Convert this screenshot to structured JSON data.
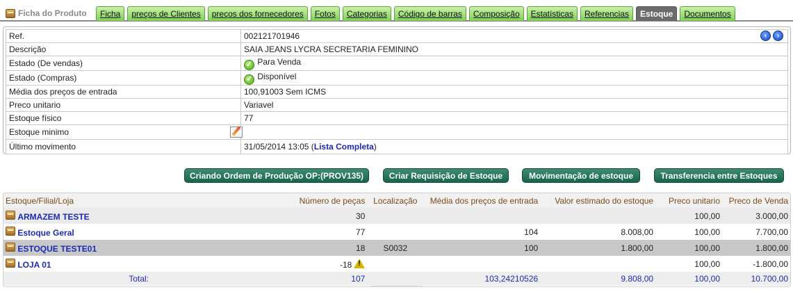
{
  "tabs": {
    "title": "Ficha do Produto",
    "items": [
      {
        "label": "Ficha"
      },
      {
        "label": "preços de Clientes"
      },
      {
        "label": "preços dos fornecedores"
      },
      {
        "label": "Fotos"
      },
      {
        "label": "Categorias"
      },
      {
        "label": "Código de barras"
      },
      {
        "label": "Composição"
      },
      {
        "label": "Estatísticas"
      },
      {
        "label": "Referencias"
      },
      {
        "label": "Estoque",
        "active": true
      },
      {
        "label": "Documentos"
      }
    ]
  },
  "details": {
    "rows": [
      {
        "label": "Ref.",
        "value": "002121701946"
      },
      {
        "label": "Descrição",
        "value": "SAIA JEANS LYCRA SECRETARIA FEMININO"
      },
      {
        "label": "Estado (De vendas)",
        "value": "Para Venda"
      },
      {
        "label": "Estado (Compras)",
        "value": "Disponível"
      },
      {
        "label": "Média dos preços de entrada",
        "value": "100,91003 Sem ICMS"
      },
      {
        "label": "Preco unitario",
        "value": "Variavel"
      },
      {
        "label": "Estoque físico",
        "value": "77"
      },
      {
        "label": "Estoque minimo",
        "value": ""
      },
      {
        "label": "Último movimento",
        "value": "31/05/2014 13:05",
        "link": "Lista Completa"
      }
    ]
  },
  "buttons": {
    "production_order": "Criando Ordem de Produção OP:(PROV135)",
    "stock_request": "Criar Requisição de Estoque",
    "stock_movement": "Movimentação de estoque",
    "stock_transfer": "Transferencia entre Estoques"
  },
  "stock_table": {
    "headers": {
      "store": "Estoque/Filial/Loja",
      "qty": "Número de peças",
      "location": "Localização",
      "avg_price": "Média dos preços de entrada",
      "est_value": "Valor estimado do estoque",
      "unit_price": "Preco unitario",
      "sale_price": "Preco de Venda"
    },
    "rows": [
      {
        "store": "ARMAZEM TESTE",
        "qty": "30",
        "location": "",
        "avg_price": "",
        "est_value": "",
        "unit_price": "100,00",
        "sale_price": "3.000,00"
      },
      {
        "store": "Estoque Geral",
        "qty": "77",
        "location": "",
        "avg_price": "104",
        "est_value": "8.008,00",
        "unit_price": "100,00",
        "sale_price": "7.700,00"
      },
      {
        "store": "ESTOQUE TESTE01",
        "qty": "18",
        "location": "S0032",
        "avg_price": "100",
        "est_value": "1.800,00",
        "unit_price": "100,00",
        "sale_price": "1.800,00"
      },
      {
        "store": "LOJA 01",
        "qty": "-18",
        "location": "",
        "avg_price": "",
        "est_value": "",
        "unit_price": "100,00",
        "sale_price": "-1.800,00"
      }
    ],
    "total": {
      "label": "Total:",
      "qty": "107",
      "avg_price": "103,24210526",
      "est_value": "9.808,00",
      "unit_price": "100,00",
      "sale_price": "10.700,00"
    }
  }
}
